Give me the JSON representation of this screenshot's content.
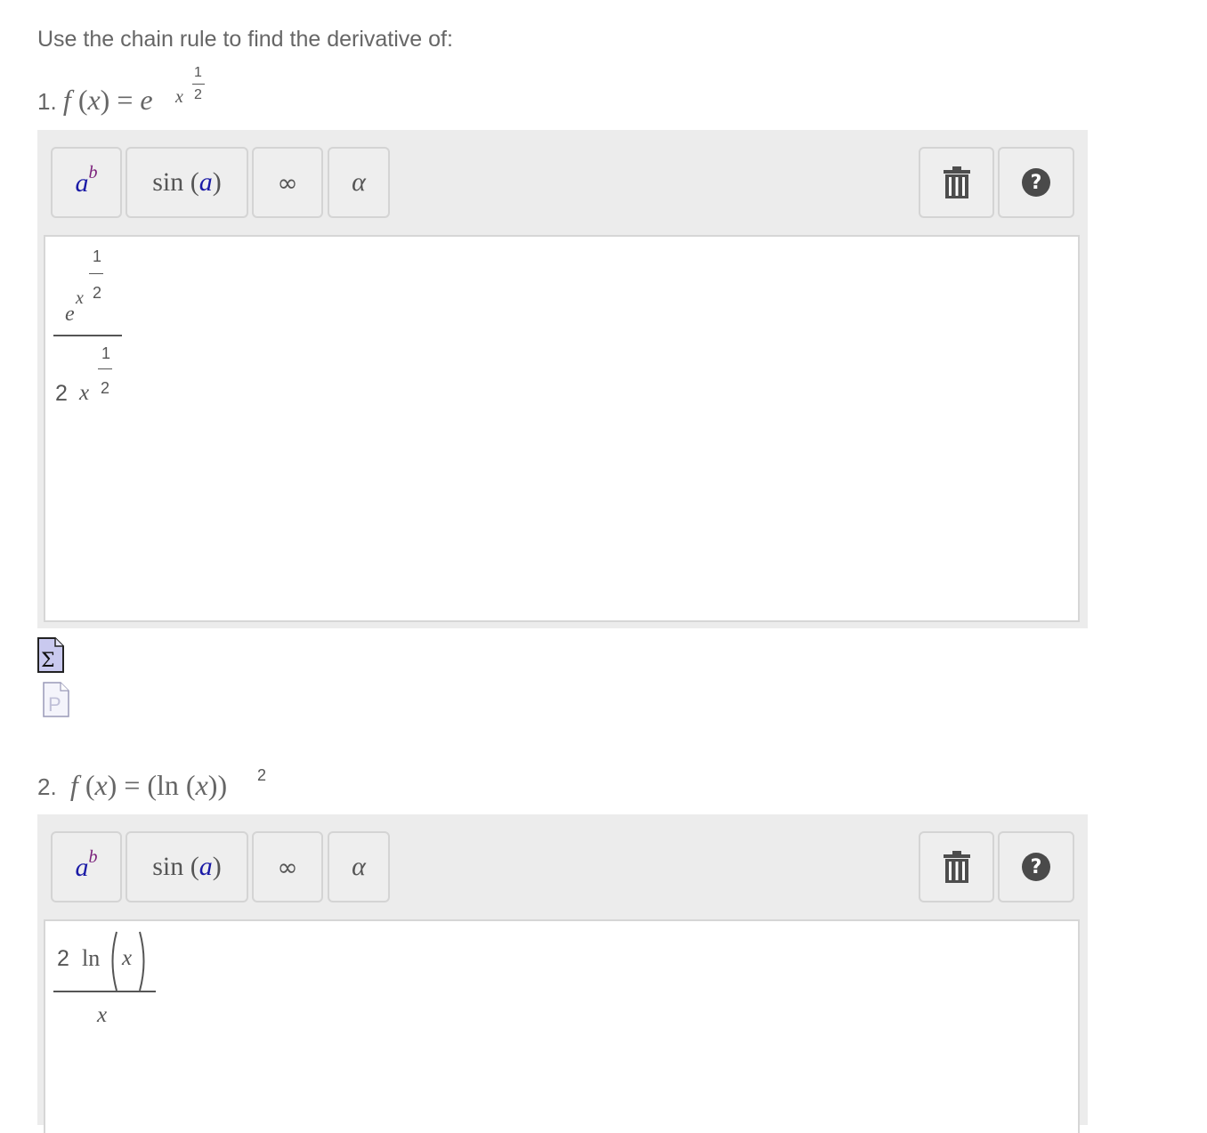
{
  "intro": "Use the chain rule to find the derivative of:",
  "questions": [
    {
      "number": "1.",
      "func": "f",
      "var": "x",
      "base": "e",
      "exp_var": "x",
      "exp_num": "1",
      "exp_den": "2",
      "answer": {
        "num_base": "e",
        "num_exp_var": "x",
        "num_exp_num": "1",
        "num_exp_den": "2",
        "den_coef": "2",
        "den_var": "x",
        "den_exp_num": "1",
        "den_exp_den": "2"
      }
    },
    {
      "number": "2.",
      "func": "f",
      "var": "x",
      "ln": "ln",
      "power": "2",
      "answer": {
        "num_coef": "2",
        "num_ln": "ln",
        "num_var": "x",
        "den_var": "x"
      }
    }
  ],
  "toolbar": {
    "power_base": "a",
    "power_exp": "b",
    "sin_label": "sin",
    "sin_arg": "a",
    "infinity": "∞",
    "alpha": "α",
    "help": "?",
    "icons": [
      "power-icon",
      "sin-icon",
      "infinity-icon",
      "alpha-icon",
      "trash-icon",
      "help-icon"
    ]
  },
  "side_icons": [
    "equation-sigma-icon",
    "preview-page-icon"
  ],
  "colors": {
    "toolbar_bg": "#ececec",
    "power_base": "#1a1aa6",
    "power_exp": "#7a1f7a",
    "help_bg": "#4a4a4a"
  }
}
